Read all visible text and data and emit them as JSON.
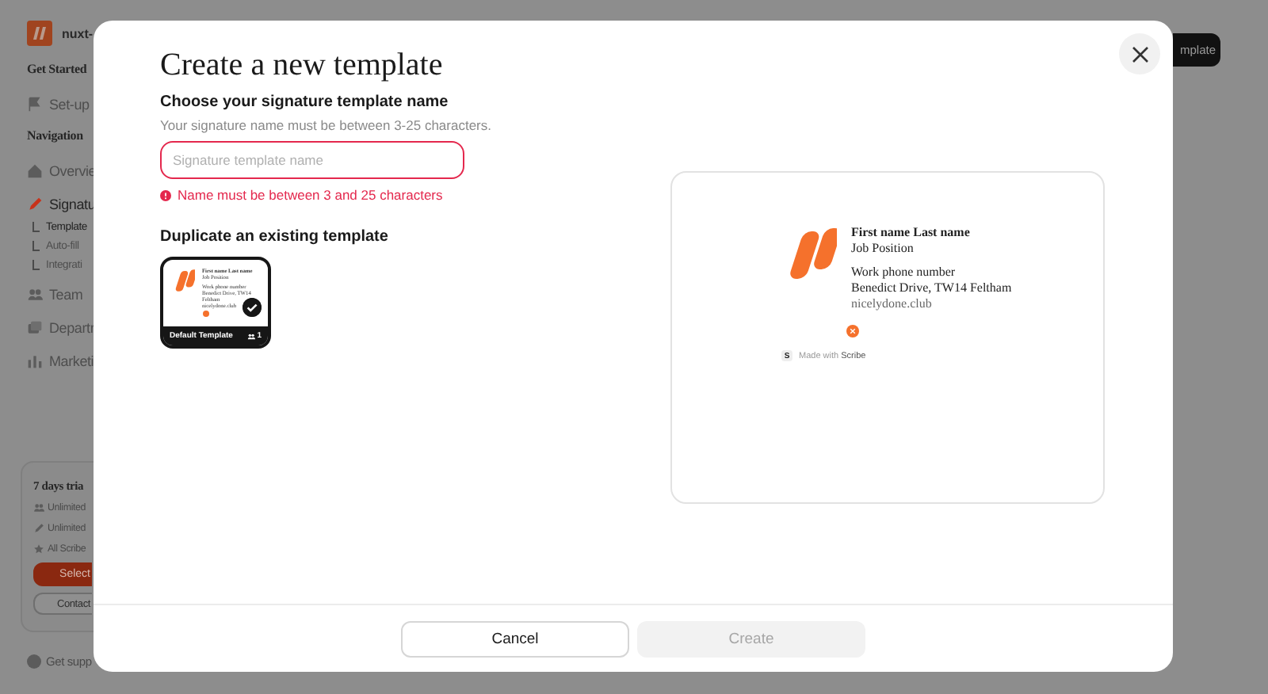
{
  "app": {
    "logo_text": "nuxt-",
    "top_button": "mplate",
    "sidebar": {
      "sections": [
        {
          "title": "Get Started",
          "items": [
            {
              "label": "Set-up",
              "kind": "flag",
              "selected": false
            }
          ]
        },
        {
          "title": "Navigation",
          "items": [
            {
              "label": "Overvie",
              "kind": "home",
              "selected": false
            },
            {
              "label": "Signatu",
              "kind": "pen",
              "selected": true,
              "children": [
                {
                  "label": "Template",
                  "selected": true
                },
                {
                  "label": "Auto-fill",
                  "selected": false
                },
                {
                  "label": "Integrati",
                  "selected": false
                }
              ]
            },
            {
              "label": "Team",
              "kind": "team",
              "selected": false
            },
            {
              "label": "Departr",
              "kind": "stack",
              "selected": false
            },
            {
              "label": "Marketi",
              "kind": "chart",
              "selected": false
            }
          ]
        }
      ]
    },
    "trial": {
      "title": "7 days tria",
      "features": [
        {
          "kind": "team",
          "label": "Unlimited"
        },
        {
          "kind": "pen",
          "label": "Unlimited"
        },
        {
          "kind": "star",
          "label": "All Scribe"
        }
      ],
      "primary": "Select",
      "secondary": "Contact"
    },
    "support": "Get supp"
  },
  "modal": {
    "title": "Create a new template",
    "name_section": {
      "heading": "Choose your signature template name",
      "hint": "Your signature name must be between 3-25 characters.",
      "placeholder": "Signature template name",
      "invalid": true,
      "error": "Name must be between 3 and 25 characters"
    },
    "duplicate": {
      "heading": "Duplicate an existing template",
      "templates": [
        {
          "name": "Default Template",
          "count": "1",
          "selected": true,
          "lines": [
            "First name Last name",
            "Job Position",
            "Work phone number",
            "Benedict Drive, TW14 Feltham",
            "nicelydone.club"
          ]
        }
      ]
    },
    "preview": {
      "name": "First name Last name",
      "position": "Job Position",
      "phone": "Work phone number",
      "address": "Benedict Drive, TW14 Feltham",
      "website": "nicelydone.club",
      "badge": "S",
      "made_with": "Made with **Scribe**"
    },
    "buttons": [
      {
        "label": "Cancel",
        "kind": "secondary",
        "disabled": false
      },
      {
        "label": "Create",
        "kind": "primary",
        "disabled": true
      }
    ]
  }
}
